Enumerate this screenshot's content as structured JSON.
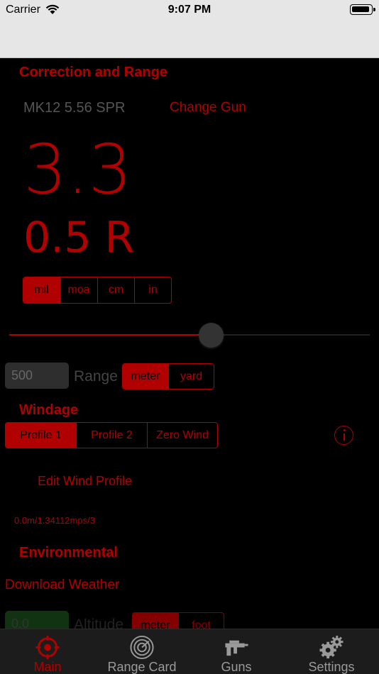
{
  "status_bar": {
    "carrier": "Carrier",
    "time": "9:07 PM"
  },
  "correction": {
    "title": "Correction and Range",
    "gun_name": "MK12 5.56 SPR",
    "change_gun_label": "Change Gun",
    "elevation": "3.3",
    "windage": "0.5 R",
    "units": [
      {
        "label": "mil",
        "selected": true
      },
      {
        "label": "moa",
        "selected": false
      },
      {
        "label": "cm",
        "selected": false
      },
      {
        "label": "in",
        "selected": false
      }
    ]
  },
  "range": {
    "value": "500",
    "label": "Range",
    "slider_fraction": 0.56,
    "units": [
      {
        "label": "meter",
        "selected": true
      },
      {
        "label": "yard",
        "selected": false
      }
    ]
  },
  "windage": {
    "title": "Windage",
    "profiles": [
      {
        "label": "Profile 1",
        "selected": true
      },
      {
        "label": "Profile 2",
        "selected": false
      },
      {
        "label": "Zero Wind",
        "selected": false
      }
    ],
    "edit_label": "Edit Wind Profile",
    "summary": "0.0m/1.34112mps/3"
  },
  "environmental": {
    "title": "Environmental",
    "download_label": "Download Weather",
    "altitude_value": "0.0",
    "altitude_label": "Altitude",
    "altitude_units": [
      {
        "label": "meter",
        "selected": true
      },
      {
        "label": "foot",
        "selected": false
      }
    ]
  },
  "tabs": [
    {
      "label": "Main",
      "icon": "crosshair-icon",
      "active": true
    },
    {
      "label": "Range Card",
      "icon": "radar-icon",
      "active": false
    },
    {
      "label": "Guns",
      "icon": "gun-icon",
      "active": false
    },
    {
      "label": "Settings",
      "icon": "gear-icon",
      "active": false
    }
  ],
  "colors": {
    "accent": "#b10000",
    "background": "#000000",
    "tab_bar": "#1c1c1c"
  }
}
